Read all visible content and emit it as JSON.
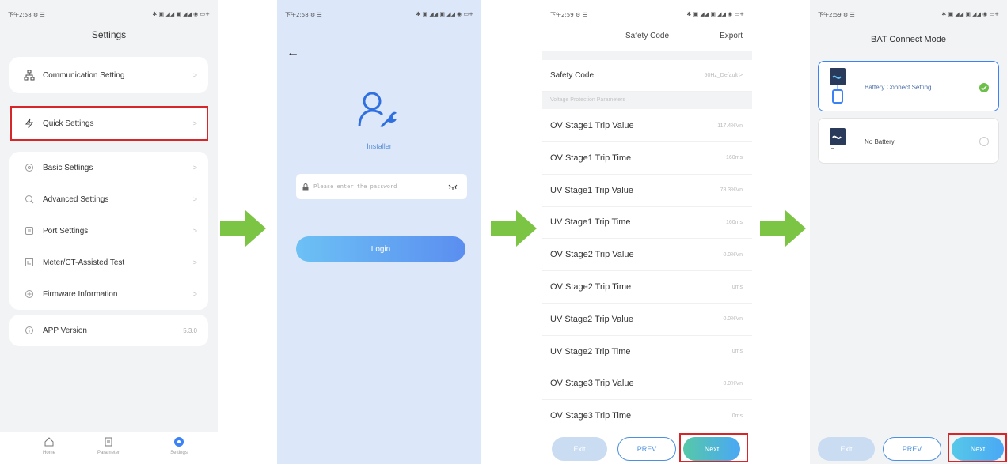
{
  "status_bar": {
    "p1": {
      "left": "下午2:58 ⚙ ☰",
      "right": "✱ ▣ ◢◢ ▣ ◢◢ ◉ ▭+"
    },
    "p2": {
      "left": "下午2:58 ⚙ ☰",
      "right": "✱ ▣ ◢◢ ▣ ◢◢ ◉ ▭+"
    },
    "p3": {
      "left": "下午2:59 ⚙ ☰",
      "right": "✱ ▣ ◢◢ ▣ ◢◢ ◉ ▭+"
    },
    "p4": {
      "left": "下午2:59 ⚙ ☰",
      "right": "✱ ▣ ◢◢ ▣ ◢◢ ◉ ▭+"
    }
  },
  "settings": {
    "title": "Settings",
    "communication": "Communication Setting",
    "quick": "Quick Settings",
    "items": [
      "Basic Settings",
      "Advanced Settings",
      "Port Settings",
      "Meter/CT-Assisted Test",
      "Firmware Information"
    ],
    "app_version_label": "APP Version",
    "app_version_value": "5.3.0",
    "chevron": ">",
    "tabs": [
      "Home",
      "Parameter",
      "Settings"
    ]
  },
  "login": {
    "back": "←",
    "role": "Installer",
    "password_placeholder": "Please enter the password",
    "button": "Login"
  },
  "safety": {
    "title": "Safety Code",
    "export": "Export",
    "safety_code_label": "Safety Code",
    "safety_code_value": "50Hz_Default >",
    "section": "Voltage Protection Parameters",
    "rows": [
      {
        "label": "OV Stage1 Trip Value",
        "value": "117.4%Vn"
      },
      {
        "label": "OV Stage1 Trip Time",
        "value": "160ms"
      },
      {
        "label": "UV Stage1 Trip Value",
        "value": "78.3%Vn"
      },
      {
        "label": "UV Stage1 Trip Time",
        "value": "160ms"
      },
      {
        "label": "OV Stage2 Trip Value",
        "value": "0.0%Vn"
      },
      {
        "label": "OV Stage2 Trip Time",
        "value": "0ms"
      },
      {
        "label": "UV Stage2 Trip Value",
        "value": "0.0%Vn"
      },
      {
        "label": "UV Stage2 Trip Time",
        "value": "0ms"
      },
      {
        "label": "OV Stage3 Trip Value",
        "value": "0.0%Vn"
      },
      {
        "label": "OV Stage3 Trip Time",
        "value": "0ms"
      }
    ],
    "exit": "Exit",
    "prev": "PREV",
    "next": "Next"
  },
  "bat": {
    "title": "BAT Connect Mode",
    "option1": "Battery Connect Setting",
    "option2": "No Battery",
    "exit": "Exit",
    "prev": "PREV",
    "next": "Next"
  },
  "colors": {
    "highlight": "#d6262a",
    "arrow": "#7cc444",
    "next_button": "#4aa8f5",
    "login_button": "#5b9ef2",
    "check": "#6cc04a"
  }
}
